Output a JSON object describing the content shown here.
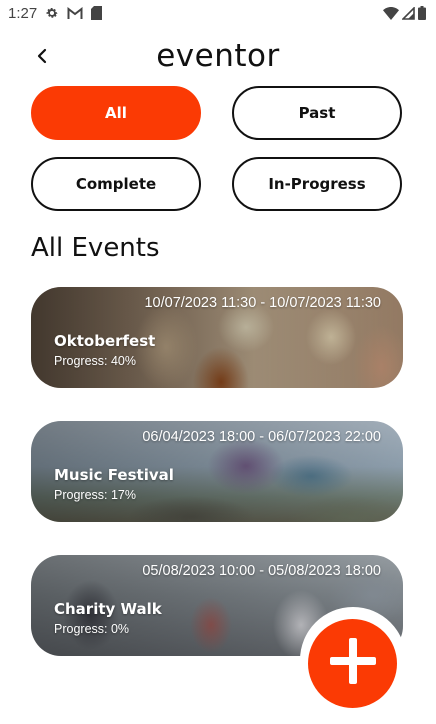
{
  "status_bar": {
    "time": "1:27",
    "left_icons": [
      "gear-icon",
      "gmail-icon",
      "sd-card-icon"
    ],
    "right_icons": [
      "wifi-icon",
      "signal-icon",
      "battery-icon"
    ]
  },
  "header": {
    "back_icon": "chevron-left-icon",
    "title": "eventor"
  },
  "filters": [
    {
      "label": "All",
      "active": true
    },
    {
      "label": "Past",
      "active": false
    },
    {
      "label": "Complete",
      "active": false
    },
    {
      "label": "In-Progress",
      "active": false
    }
  ],
  "section_title": "All Events",
  "events": [
    {
      "dates": "10/07/2023 11:30 - 10/07/2023 11:30",
      "name": "Oktoberfest",
      "progress": "Progress: 40%"
    },
    {
      "dates": "06/04/2023 18:00 - 06/07/2023 22:00",
      "name": "Music Festival",
      "progress": "Progress: 17%"
    },
    {
      "dates": "05/08/2023 10:00 - 05/08/2023 18:00",
      "name": "Charity Walk",
      "progress": "Progress: 0%"
    }
  ],
  "fab": {
    "icon": "plus-icon"
  },
  "colors": {
    "accent": "#fb3a04",
    "text": "#111111",
    "background": "#ffffff"
  }
}
